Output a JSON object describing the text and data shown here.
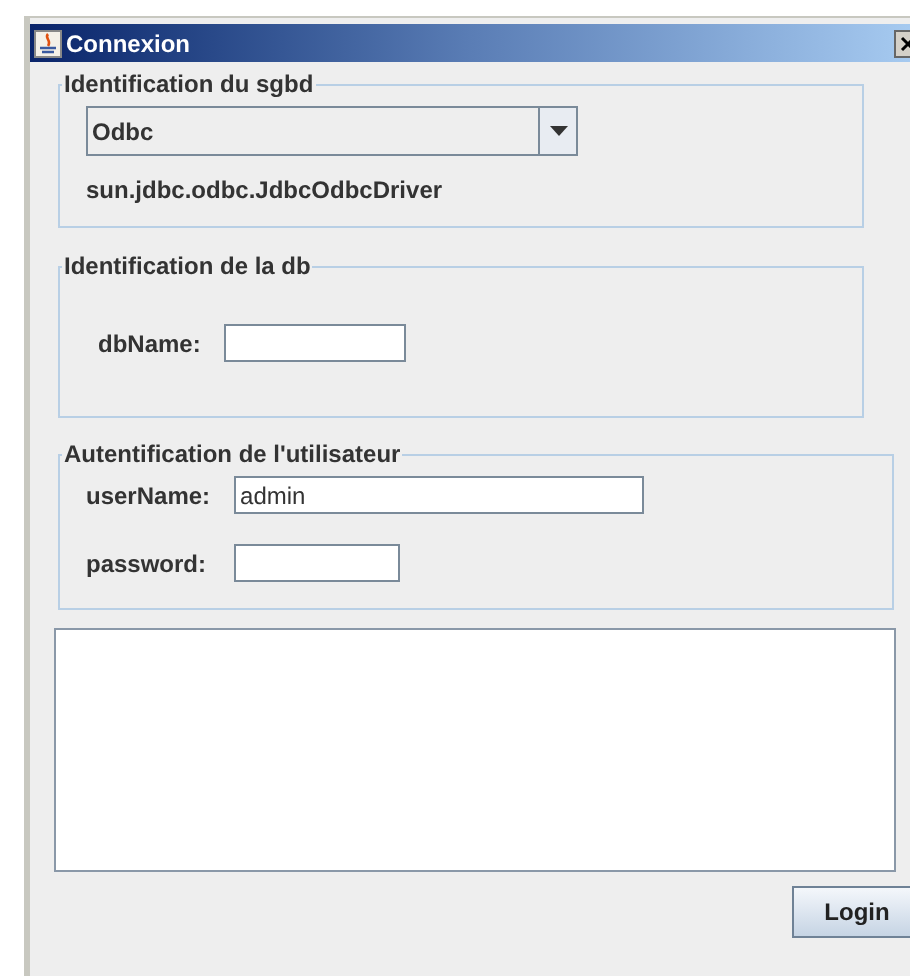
{
  "window": {
    "title": "Connexion"
  },
  "sgbd_group": {
    "legend": "Identification du sgbd",
    "driver_select": {
      "value": "Odbc"
    },
    "driver_class": "sun.jdbc.odbc.JdbcOdbcDriver"
  },
  "db_group": {
    "legend": "Identification de la db",
    "fields": [
      {
        "label": "dbName:"
      }
    ]
  },
  "user_group": {
    "legend": "Autentification de l'utilisateur",
    "fields": [
      {
        "label": "userName:",
        "value": "admin"
      },
      {
        "label": "password:"
      }
    ]
  },
  "login_button": "Login"
}
